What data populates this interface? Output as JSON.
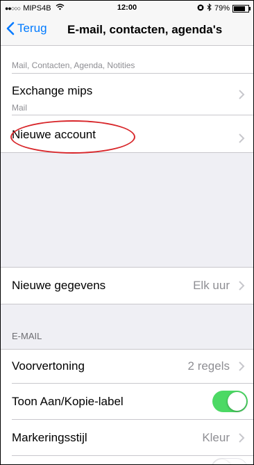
{
  "status_bar": {
    "signal": "●●○○○",
    "carrier": "MIPS4B",
    "wifi_icon": "wifi-icon",
    "time": "12:00",
    "battery_percent": "79%",
    "battery_level": 0.79
  },
  "nav": {
    "back_label": "Terug",
    "title": "E-mail, contacten, agenda's"
  },
  "accounts": {
    "partial_sub": "Mail, Contacten, Agenda, Notities",
    "exchange_label": "Exchange mips",
    "exchange_sub": "Mail",
    "new_account_label": "Nieuwe account"
  },
  "fetch": {
    "label": "Nieuwe gegevens",
    "value": "Elk uur"
  },
  "email_section": {
    "header": "E-MAIL",
    "preview_label": "Voorvertoning",
    "preview_value": "2 regels",
    "show_tocc_label": "Toon Aan/Kopie-label",
    "show_tocc_on": true,
    "flag_style_label": "Markeringsstijl",
    "flag_style_value": "Kleur"
  },
  "colors": {
    "accent": "#007aff",
    "toggle_on": "#4cd964",
    "annotation": "#d8262a"
  }
}
